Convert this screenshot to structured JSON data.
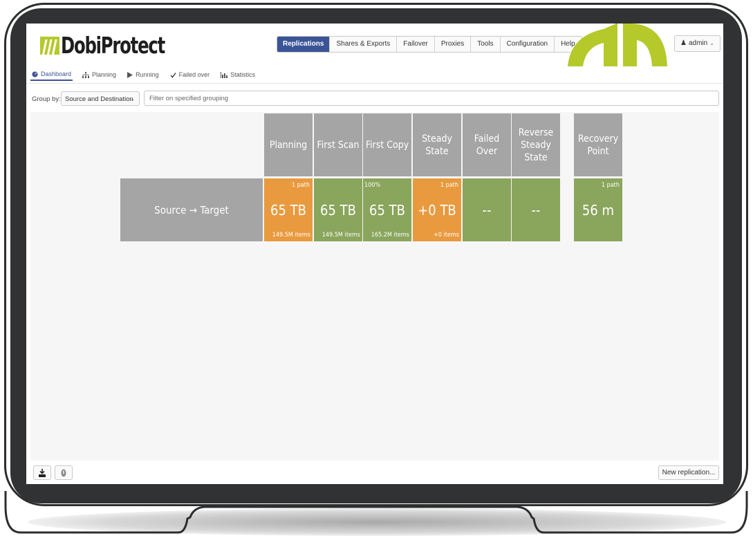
{
  "app": {
    "name": "DobiProtect",
    "accent_color": "#3a5496",
    "brand_green": "#b5c92b"
  },
  "main_nav": [
    {
      "label": "Replications",
      "active": true
    },
    {
      "label": "Shares & Exports",
      "active": false
    },
    {
      "label": "Failover",
      "active": false
    },
    {
      "label": "Proxies",
      "active": false
    },
    {
      "label": "Tools",
      "active": false
    },
    {
      "label": "Configuration",
      "active": false
    },
    {
      "label": "Help",
      "active": false
    }
  ],
  "user_menu": {
    "label": "admin",
    "icon": "user-icon"
  },
  "sub_nav": [
    {
      "label": "Dashboard",
      "icon": "dashboard-icon",
      "active": true
    },
    {
      "label": "Planning",
      "icon": "sitemap-icon",
      "active": false
    },
    {
      "label": "Running",
      "icon": "play-icon",
      "active": false
    },
    {
      "label": "Failed over",
      "icon": "check-icon",
      "active": false
    },
    {
      "label": "Statistics",
      "icon": "bar-chart-icon",
      "active": false
    }
  ],
  "filter": {
    "group_by_label": "Group by:",
    "group_by_value": "Source and Destination",
    "filter_placeholder": "Filter on specified grouping"
  },
  "dashboard": {
    "columns": [
      {
        "label": "Planning"
      },
      {
        "label": "First Scan"
      },
      {
        "label": "First Copy"
      },
      {
        "label": "Steady State"
      },
      {
        "label": "Failed Over"
      },
      {
        "label": "Reverse Steady State"
      },
      {
        "label": "Recovery Point"
      }
    ],
    "row_label": "Source → Target",
    "cells": [
      {
        "top": "1 path",
        "value": "65 TB",
        "bottom": "149.5M items",
        "status": "orange"
      },
      {
        "top": "",
        "value": "65 TB",
        "bottom": "149.5M items",
        "status": "green"
      },
      {
        "top": "100%",
        "value": "65 TB",
        "bottom": "165.2M items",
        "status": "green"
      },
      {
        "top": "1 path",
        "value": "+0 TB",
        "bottom": "+0 items",
        "status": "orange"
      },
      {
        "top": "",
        "value": "--",
        "bottom": "",
        "status": "green"
      },
      {
        "top": "",
        "value": "--",
        "bottom": "",
        "status": "green"
      },
      {
        "top": "1 path",
        "value": "56 m",
        "bottom": "",
        "status": "green"
      }
    ],
    "status_colors": {
      "orange": "#e99a3e",
      "green": "#8aa55c",
      "header": "#a5a5a5"
    }
  },
  "footer": {
    "download_icon": "download-icon",
    "info_icon": "info-icon",
    "new_replication_label": "New replication..."
  }
}
